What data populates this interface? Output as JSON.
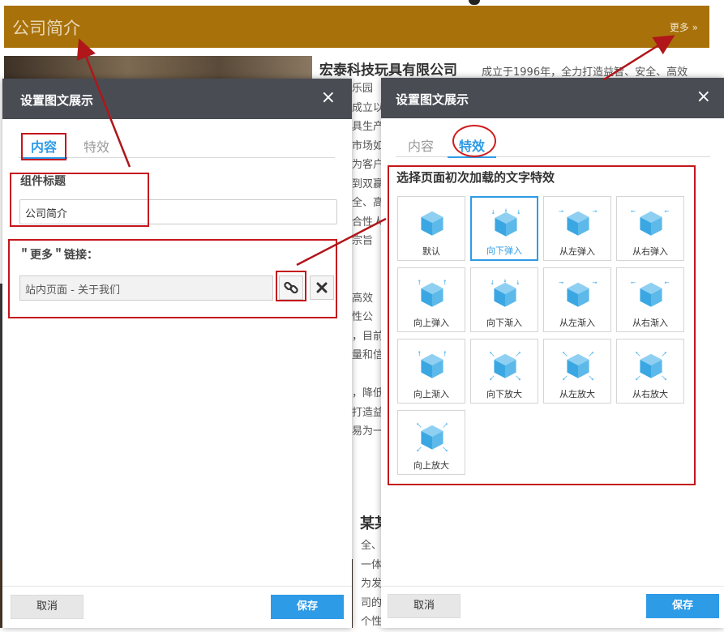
{
  "background": {
    "header_title": "公司简介",
    "more_link": "更多 »",
    "company_name": "宏泰科技玩具有限公司",
    "company_desc": "成立于1996年，全力打造益智、安全、高效",
    "column_lines": [
      "乐园",
      "成立以",
      "具生产",
      "市场如",
      "为客户",
      "到双赢",
      "全、高",
      "合性人",
      "宗旨",
      "",
      "",
      "高效",
      "性公",
      "，目前",
      "量和信",
      "",
      "，降低",
      "打造益",
      "易为一"
    ],
    "heading2": "某某",
    "column2_lines": [
      "全、",
      "一体",
      "为发",
      "司的",
      "个性"
    ]
  },
  "left_dialog": {
    "title": "设置图文展示",
    "close": "×",
    "tabs": [
      {
        "label": "内容",
        "active": true
      },
      {
        "label": "特效",
        "active": false
      }
    ],
    "component_title_label": "组件标题",
    "component_title_value": "公司简介",
    "more_link_label": "＂更多＂链接：",
    "more_link_value": "站内页面 - 关于我们",
    "link_icon": "link-icon",
    "remove_icon": "remove-icon",
    "cancel": "取消",
    "save": "保存"
  },
  "right_dialog": {
    "title": "设置图文展示",
    "close": "×",
    "tabs": [
      {
        "label": "内容",
        "active": false
      },
      {
        "label": "特效",
        "active": true
      }
    ],
    "effects_title": "选择页面初次加载的文字特效",
    "selected_effect": "向下弹入",
    "effects": [
      {
        "label": "默认",
        "arrows": "none"
      },
      {
        "label": "向下弹入",
        "arrows": "down"
      },
      {
        "label": "从左弹入",
        "arrows": "right"
      },
      {
        "label": "从右弹入",
        "arrows": "left"
      },
      {
        "label": "向上弹入",
        "arrows": "up"
      },
      {
        "label": "向下渐入",
        "arrows": "down"
      },
      {
        "label": "从左渐入",
        "arrows": "right"
      },
      {
        "label": "从右渐入",
        "arrows": "left"
      },
      {
        "label": "向上渐入",
        "arrows": "up"
      },
      {
        "label": "向下放大",
        "arrows": "expand"
      },
      {
        "label": "从左放大",
        "arrows": "expand"
      },
      {
        "label": "从右放大",
        "arrows": "expand"
      },
      {
        "label": "向上放大",
        "arrows": "expand"
      }
    ],
    "cancel": "取消",
    "save": "保存"
  },
  "colors": {
    "accent": "#2e9be6",
    "header_bar": "#a8710a",
    "dialog_header": "#4a4c54",
    "annotation": "#c4161c",
    "cube_light": "#8fd0f2",
    "cube_dark": "#3aa7e3"
  }
}
